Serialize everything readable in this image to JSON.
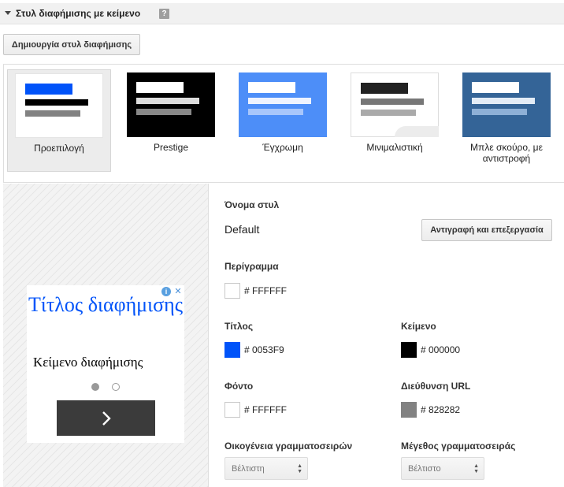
{
  "header": {
    "title": "Στυλ διαφήμισης με κείμενο",
    "help": "?"
  },
  "create_button": "Δημιουργία στυλ διαφήμισης",
  "styles": [
    {
      "label": "Προεπιλογή",
      "selected": true
    },
    {
      "label": "Prestige",
      "selected": false
    },
    {
      "label": "Έγχρωμη",
      "selected": false
    },
    {
      "label": "Μινιμαλιστική",
      "selected": false
    },
    {
      "label": "Μπλε σκούρο, με αντιστροφή",
      "selected": false
    }
  ],
  "preview": {
    "ad_title": "Τίτλος διαφήμισης",
    "ad_text": "Κείμενο διαφήμισης",
    "cta_icon": "chevron-right-icon",
    "carousel_active_index": 0,
    "carousel_count": 2
  },
  "settings": {
    "style_name_label": "Όνομα στυλ",
    "style_name_value": "Default",
    "copy_edit_button": "Αντιγραφή και επεξεργασία",
    "border": {
      "label": "Περίγραμμα",
      "hex": "# FFFFFF",
      "color": "#FFFFFF"
    },
    "title": {
      "label": "Τίτλος",
      "hex": "# 0053F9",
      "color": "#0053F9"
    },
    "text": {
      "label": "Κείμενο",
      "hex": "# 000000",
      "color": "#000000"
    },
    "background": {
      "label": "Φόντο",
      "hex": "# FFFFFF",
      "color": "#FFFFFF"
    },
    "url": {
      "label": "Διεύθυνση URL",
      "hex": "# 828282",
      "color": "#828282"
    },
    "font_family": {
      "label": "Οικογένεια γραμματοσειρών",
      "value": "Βέλτιστη"
    },
    "font_size": {
      "label": "Μέγεθος γραμματοσειράς",
      "value": "Βέλτιστο"
    }
  }
}
